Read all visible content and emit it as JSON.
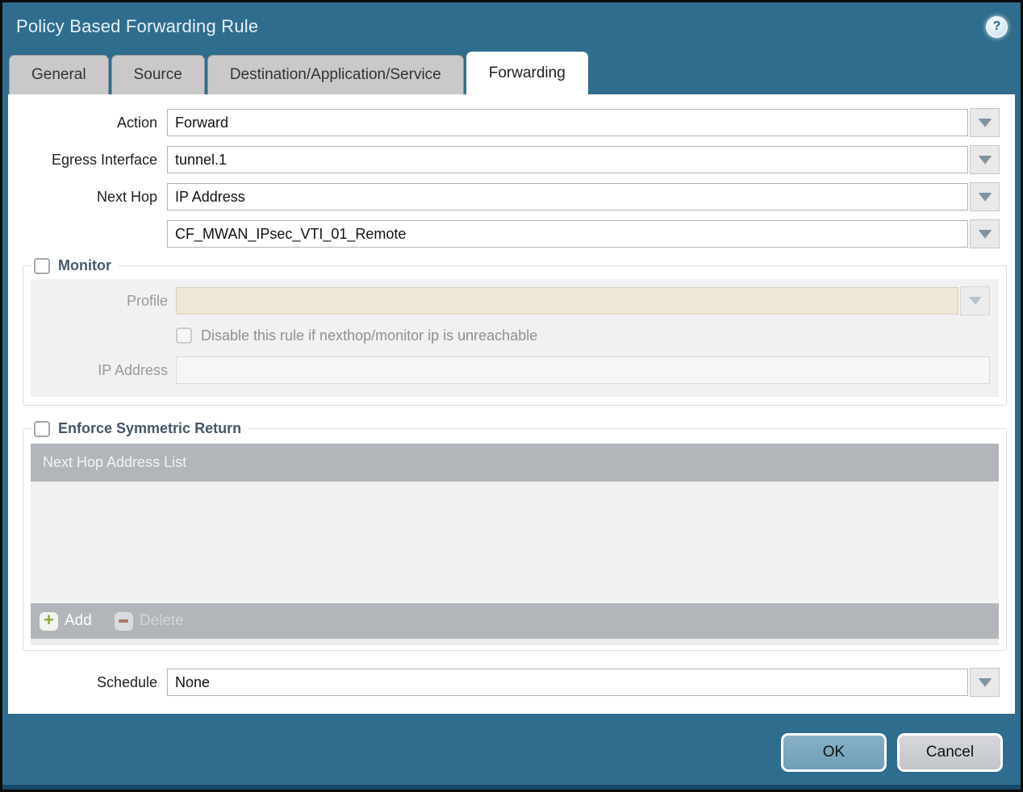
{
  "dialog": {
    "title": "Policy Based Forwarding Rule"
  },
  "tabs": [
    {
      "label": "General",
      "active": false
    },
    {
      "label": "Source",
      "active": false
    },
    {
      "label": "Destination/Application/Service",
      "active": false
    },
    {
      "label": "Forwarding",
      "active": true
    }
  ],
  "form": {
    "action_label": "Action",
    "action_value": "Forward",
    "egress_label": "Egress Interface",
    "egress_value": "tunnel.1",
    "next_hop_label": "Next Hop",
    "next_hop_value": "IP Address",
    "next_hop_address_value": "CF_MWAN_IPsec_VTI_01_Remote",
    "schedule_label": "Schedule",
    "schedule_value": "None"
  },
  "monitor": {
    "legend": "Monitor",
    "checked": false,
    "profile_label": "Profile",
    "profile_value": "",
    "disable_rule_label": "Disable this rule if nexthop/monitor ip is unreachable",
    "disable_rule_checked": false,
    "ip_address_label": "IP Address",
    "ip_address_value": ""
  },
  "symmetric_return": {
    "legend": "Enforce Symmetric Return",
    "checked": false,
    "table_header": "Next Hop Address List",
    "rows": [],
    "add_label": "Add",
    "delete_label": "Delete"
  },
  "footer": {
    "ok_label": "OK",
    "cancel_label": "Cancel"
  },
  "help": {
    "glyph": "?"
  },
  "colors": {
    "titlebar_teal": "#2e6d8e",
    "footer_teal": "#2e6d8e",
    "bottom_strip_navy": "#16486a",
    "ok_button_blue": "#7aa8be",
    "cancel_button_gray": "#c9ccd0",
    "tab_inactive_gray": "#c9c9c9",
    "tab_active_white": "#ffffff",
    "legend_slate": "#45586b",
    "disabled_field_cream": "#ede7d5",
    "panel_gray": "#f1f1f1",
    "table_gray": "#b2b6ba",
    "add_icon_green": "#8ca63d",
    "delete_icon_red": "#b0786a",
    "dropdown_arrow_steel": "#7e93a2"
  }
}
